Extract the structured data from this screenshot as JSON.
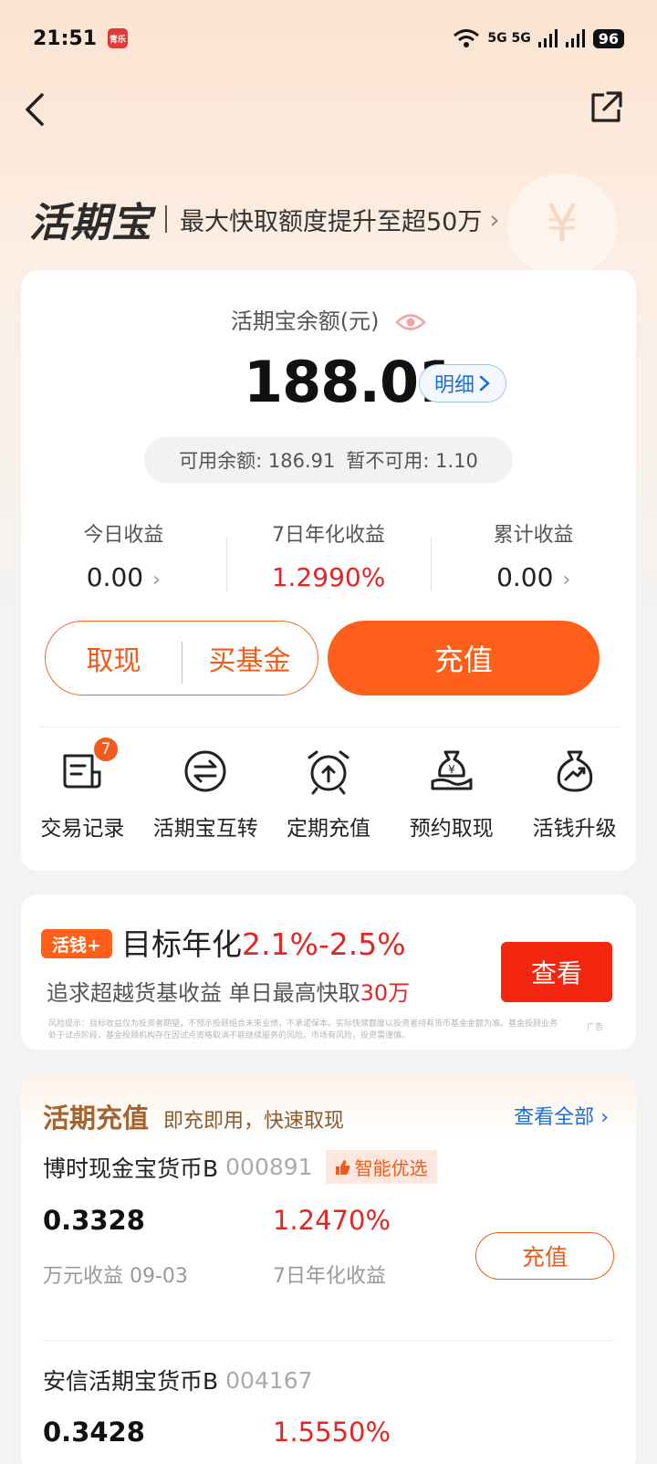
{
  "status_bar": {
    "time": "21:51",
    "app_badge": "青乐",
    "network": "5G 5G",
    "battery": "96"
  },
  "header": {
    "brand": "活期宝",
    "promo": "最大快取额度提升至超50万"
  },
  "balance": {
    "label": "活期宝余额(元)",
    "amount": "188.01",
    "detail_label": "明细",
    "available": "可用余额: 186.91",
    "unavailable": "暂不可用: 1.10"
  },
  "stats": [
    {
      "label": "今日收益",
      "value": "0.00"
    },
    {
      "label": "7日年化收益",
      "value": "1.2990%"
    },
    {
      "label": "累计收益",
      "value": "0.00"
    }
  ],
  "actions": {
    "withdraw": "取现",
    "buy_fund": "买基金",
    "recharge": "充值"
  },
  "quick_actions": [
    {
      "label": "交易记录",
      "icon": "document-icon",
      "badge": "7"
    },
    {
      "label": "活期宝互转",
      "icon": "transfer-icon"
    },
    {
      "label": "定期充值",
      "icon": "alarm-clock-icon"
    },
    {
      "label": "预约取现",
      "icon": "money-bag-hand-icon"
    },
    {
      "label": "活钱升级",
      "icon": "money-bag-up-icon"
    }
  ],
  "ad": {
    "tag": "活钱+",
    "title_prefix": "目标年化",
    "title_rate": "2.1%-2.5%",
    "subtitle_prefix": "追求超越货基收益  单日最高快取",
    "subtitle_amount": "30万",
    "button": "查看",
    "disclaimer": "风险提示：目标收益仅为投资者期望，不预示投顾组合未来业绩，不承诺保本。实际快赎额度以投资者持有货币基金金额为准。基金投顾业务处于试点阶段，基金投顾机构存在因试点资格取消不能继续服务的风险。市场有风险，投资需谨慎。",
    "ad_mark": "广告"
  },
  "fund_section": {
    "title": "活期充值",
    "subtitle": "即充即用，快速取现",
    "view_all": "查看全部",
    "funds": [
      {
        "name": "博时现金宝货币B",
        "code": "000891",
        "tag": "智能优选",
        "yield_10k": "0.3328",
        "yield_10k_label": "万元收益 09-03",
        "annual": "1.2470%",
        "annual_label": "7日年化收益",
        "button": "充值"
      },
      {
        "name": "安信活期宝货币B",
        "code": "004167",
        "yield_10k": "0.3428",
        "annual": "1.5550%"
      }
    ]
  },
  "colors": {
    "accent": "#ff5f1a",
    "red": "#e52424",
    "blue": "#1a6ed8"
  }
}
